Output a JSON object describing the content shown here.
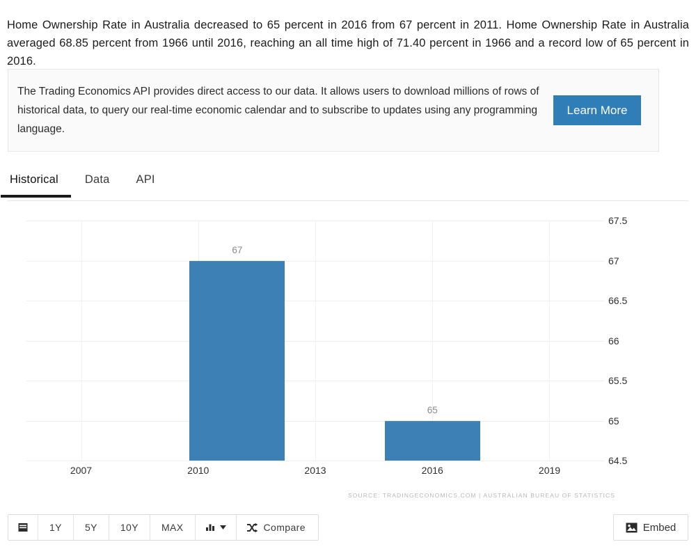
{
  "intro": {
    "text": "Home Ownership Rate in Australia decreased to 65 percent in 2016 from 67 percent in 2011. Home Ownership Rate in Australia averaged 68.85 percent from 1966 until 2016, reaching an all time high of 71.40 percent in 1966 and a record low of 65 percent in 2016."
  },
  "api_promo": {
    "text": "The Trading Economics API provides direct access to our data. It allows users to download millions of rows of historical data, to query our real-time economic calendar and to subscribe to updates using any programming language.",
    "button_label": "Learn More",
    "button_color": "#2f7eb8"
  },
  "tabs": [
    {
      "label": "Historical",
      "active": true
    },
    {
      "label": "Data",
      "active": false
    },
    {
      "label": "API",
      "active": false
    }
  ],
  "chart_data": {
    "type": "bar",
    "title": "",
    "subtitle": "",
    "xlabel": "",
    "ylabel": "",
    "categories": [
      "2011",
      "2016"
    ],
    "values": [
      67,
      65
    ],
    "data_labels": [
      "67",
      "65"
    ],
    "series": [
      {
        "name": "Home Ownership Rate",
        "values": [
          67,
          65
        ]
      }
    ],
    "ylim": [
      64.5,
      67.5
    ],
    "y_ticks": [
      "67.5",
      "67",
      "66.5",
      "66",
      "65.5",
      "65",
      "64.5"
    ],
    "y_tick_values": [
      67.5,
      67,
      66.5,
      66,
      65.5,
      65,
      64.5
    ],
    "x_ticks": [
      "2007",
      "2010",
      "2013",
      "2016",
      "2019"
    ],
    "x_tick_values": [
      2007,
      2010,
      2013,
      2016,
      2019
    ],
    "xlim": [
      2005.6,
      2020.4
    ],
    "grid": true,
    "legend": "none",
    "bar_color": "#3d80b5",
    "unit": "percent",
    "source": "SOURCE: TRADINGECONOMICS.COM  |  AUSTRALIAN BUREAU OF STATISTICS"
  },
  "toolbar": {
    "range_buttons": [
      "1Y",
      "5Y",
      "10Y",
      "MAX"
    ],
    "calendar_button_label": "",
    "charttype_button_label": "",
    "compare_label": "Compare",
    "embed_label": "Embed"
  }
}
